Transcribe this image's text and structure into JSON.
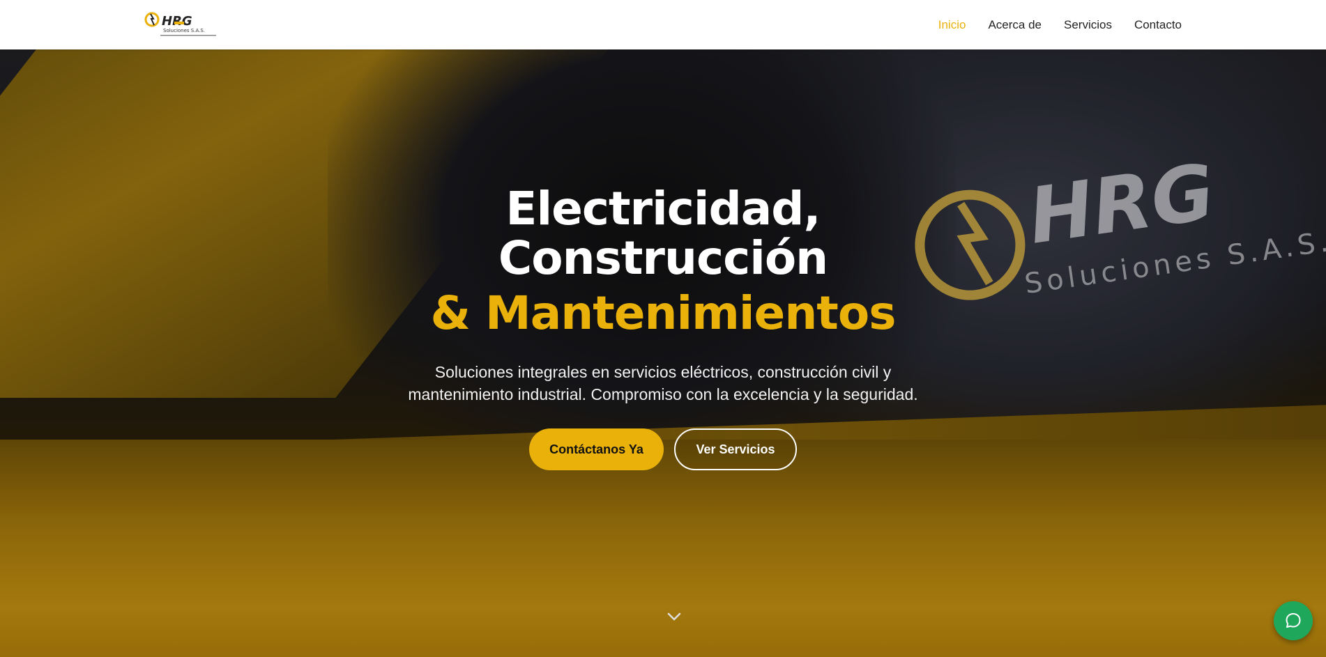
{
  "header": {
    "logo": {
      "text_main": "HRG",
      "text_sub": "Soluciones S.A.S."
    },
    "nav": [
      {
        "label": "Inicio",
        "active": true
      },
      {
        "label": "Acerca de",
        "active": false
      },
      {
        "label": "Servicios",
        "active": false
      },
      {
        "label": "Contacto",
        "active": false
      }
    ]
  },
  "hero": {
    "title_line1": "Electricidad,",
    "title_line2": "Construcción",
    "title_line3": "& Mantenimientos",
    "subtitle_line1": "Soluciones integrales en servicios eléctricos, construcción civil y",
    "subtitle_line2": "mantenimiento industrial. Compromiso con la excelencia y la seguridad.",
    "primary_button": "Contáctanos Ya",
    "secondary_button": "Ver Servicios",
    "scroll_icon": "chevron-down-icon",
    "watermark": {
      "text_main": "HRG",
      "text_sub": "Soluciones S.A.S."
    }
  },
  "chat": {
    "icon": "chat-bubble-icon"
  },
  "colors": {
    "accent": "#e9b10a",
    "header_bg": "#ffffff",
    "nav_text": "#222222",
    "chat_green": "#1fa85b"
  }
}
